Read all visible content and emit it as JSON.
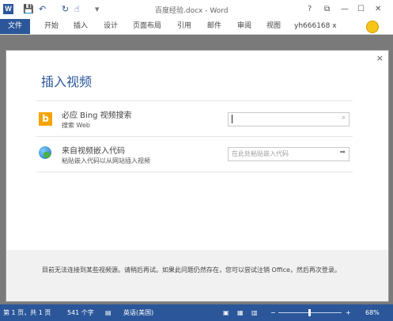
{
  "titlebar": {
    "logo": "W",
    "doc_title": "百度经验.docx - Word",
    "quick_access": {
      "save": "💾",
      "undo": "↶",
      "redo": "↻",
      "touch": "☝",
      "customize": "▾"
    },
    "controls": {
      "help": "?",
      "ribbon_options": "⧉",
      "minimize": "—",
      "restore": "☐",
      "close": "✕"
    }
  },
  "ribbon": {
    "file_tab": "文件",
    "tabs": [
      "开始",
      "插入",
      "设计",
      "页面布局",
      "引用",
      "邮件",
      "审阅",
      "视图"
    ],
    "user": "yh666168 x"
  },
  "dialog": {
    "title": "插入视频",
    "close": "×",
    "bing": {
      "icon_letter": "b",
      "title": "必应 Bing 视频搜索",
      "subtitle": "搜索 Web",
      "search_icon": "⌕"
    },
    "embed": {
      "title": "来自视频嵌入代码",
      "subtitle": "粘贴嵌入代码以从网站插入视频",
      "placeholder": "在此处粘贴嵌入代码",
      "go_icon": "➡"
    },
    "footer_text": "目前无法连接到某些视频源。请稍后再试。如果此问题仍然存在，您可以尝试注销 Office，然后再次登录。"
  },
  "statusbar": {
    "page": "第 1 页，共 1 页",
    "words": "541 个字",
    "language": "英语(美国)",
    "zoom_out": "−",
    "zoom_in": "+",
    "zoom": "68%"
  },
  "colors": {
    "accent": "#2b579a",
    "bing": "#f5a300"
  }
}
